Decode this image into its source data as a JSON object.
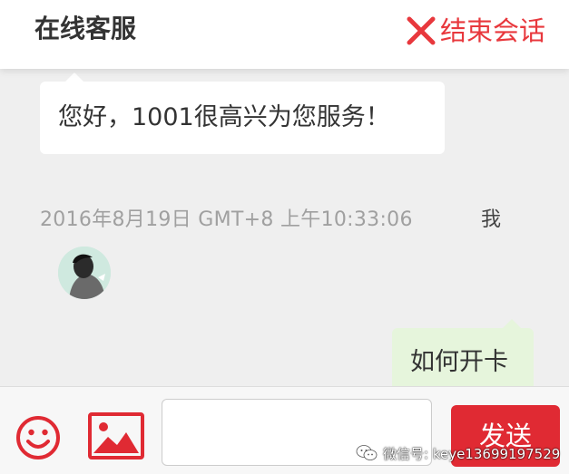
{
  "header": {
    "title": "在线客服",
    "end_label": "结束会话"
  },
  "messages": {
    "agent_text": "您好，1001很高兴为您服务！",
    "timestamp": "2016年8月19日 GMT+8 上午10:33:06",
    "sender": "我",
    "user_text": "如何开卡"
  },
  "composer": {
    "input_value": "",
    "send_label": "发送"
  },
  "watermark": {
    "text": "微信号: keye13699197529"
  },
  "colors": {
    "accent_red": "#e02a33",
    "end_red": "#e8383d",
    "user_bubble": "#e6f5dc",
    "background": "#efefef"
  },
  "icons": [
    "close-icon",
    "emoji-icon",
    "image-icon",
    "wechat-icon"
  ]
}
